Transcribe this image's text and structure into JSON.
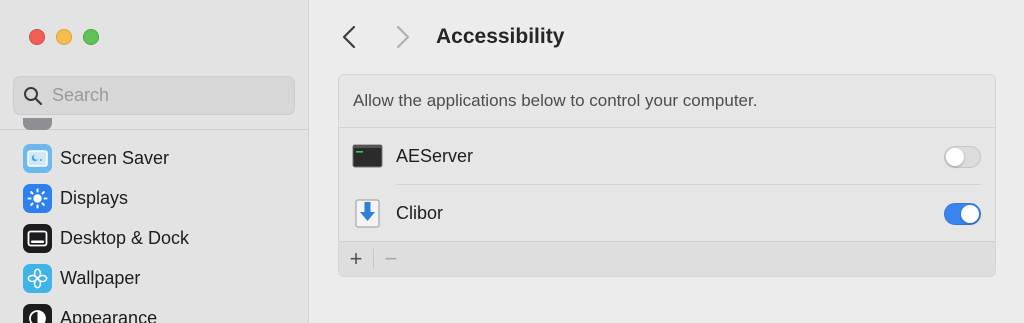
{
  "window_controls": [
    "close",
    "minimize",
    "zoom"
  ],
  "search": {
    "placeholder": "Search",
    "icon": "search-icon"
  },
  "sidebar": {
    "items": [
      {
        "label": "",
        "icon": "partial-item-icon"
      },
      {
        "label": "Screen Saver",
        "icon": "screen-saver-icon",
        "color": "#63b3ee"
      },
      {
        "label": "Displays",
        "icon": "displays-icon",
        "color": "#2f80ef"
      },
      {
        "label": "Desktop & Dock",
        "icon": "desktop-dock-icon",
        "color": "#1c1c1e"
      },
      {
        "label": "Wallpaper",
        "icon": "wallpaper-icon",
        "color": "#3fb4e8"
      },
      {
        "label": "Appearance",
        "icon": "appearance-icon",
        "color": "#1c1c1e"
      }
    ]
  },
  "toolbar": {
    "back_icon": "chevron-left-icon",
    "forward_icon": "chevron-right-icon",
    "title": "Accessibility"
  },
  "panel": {
    "header": "Allow the applications below to control your computer.",
    "apps": [
      {
        "name": "AEServer",
        "enabled": false
      },
      {
        "name": "Clibor",
        "enabled": true
      }
    ],
    "footer": {
      "add": "+",
      "remove": "−"
    }
  },
  "colors": {
    "accent": "#3b84f0",
    "sidebar_bg": "#e3e3e3",
    "content_bg": "#ececec"
  }
}
